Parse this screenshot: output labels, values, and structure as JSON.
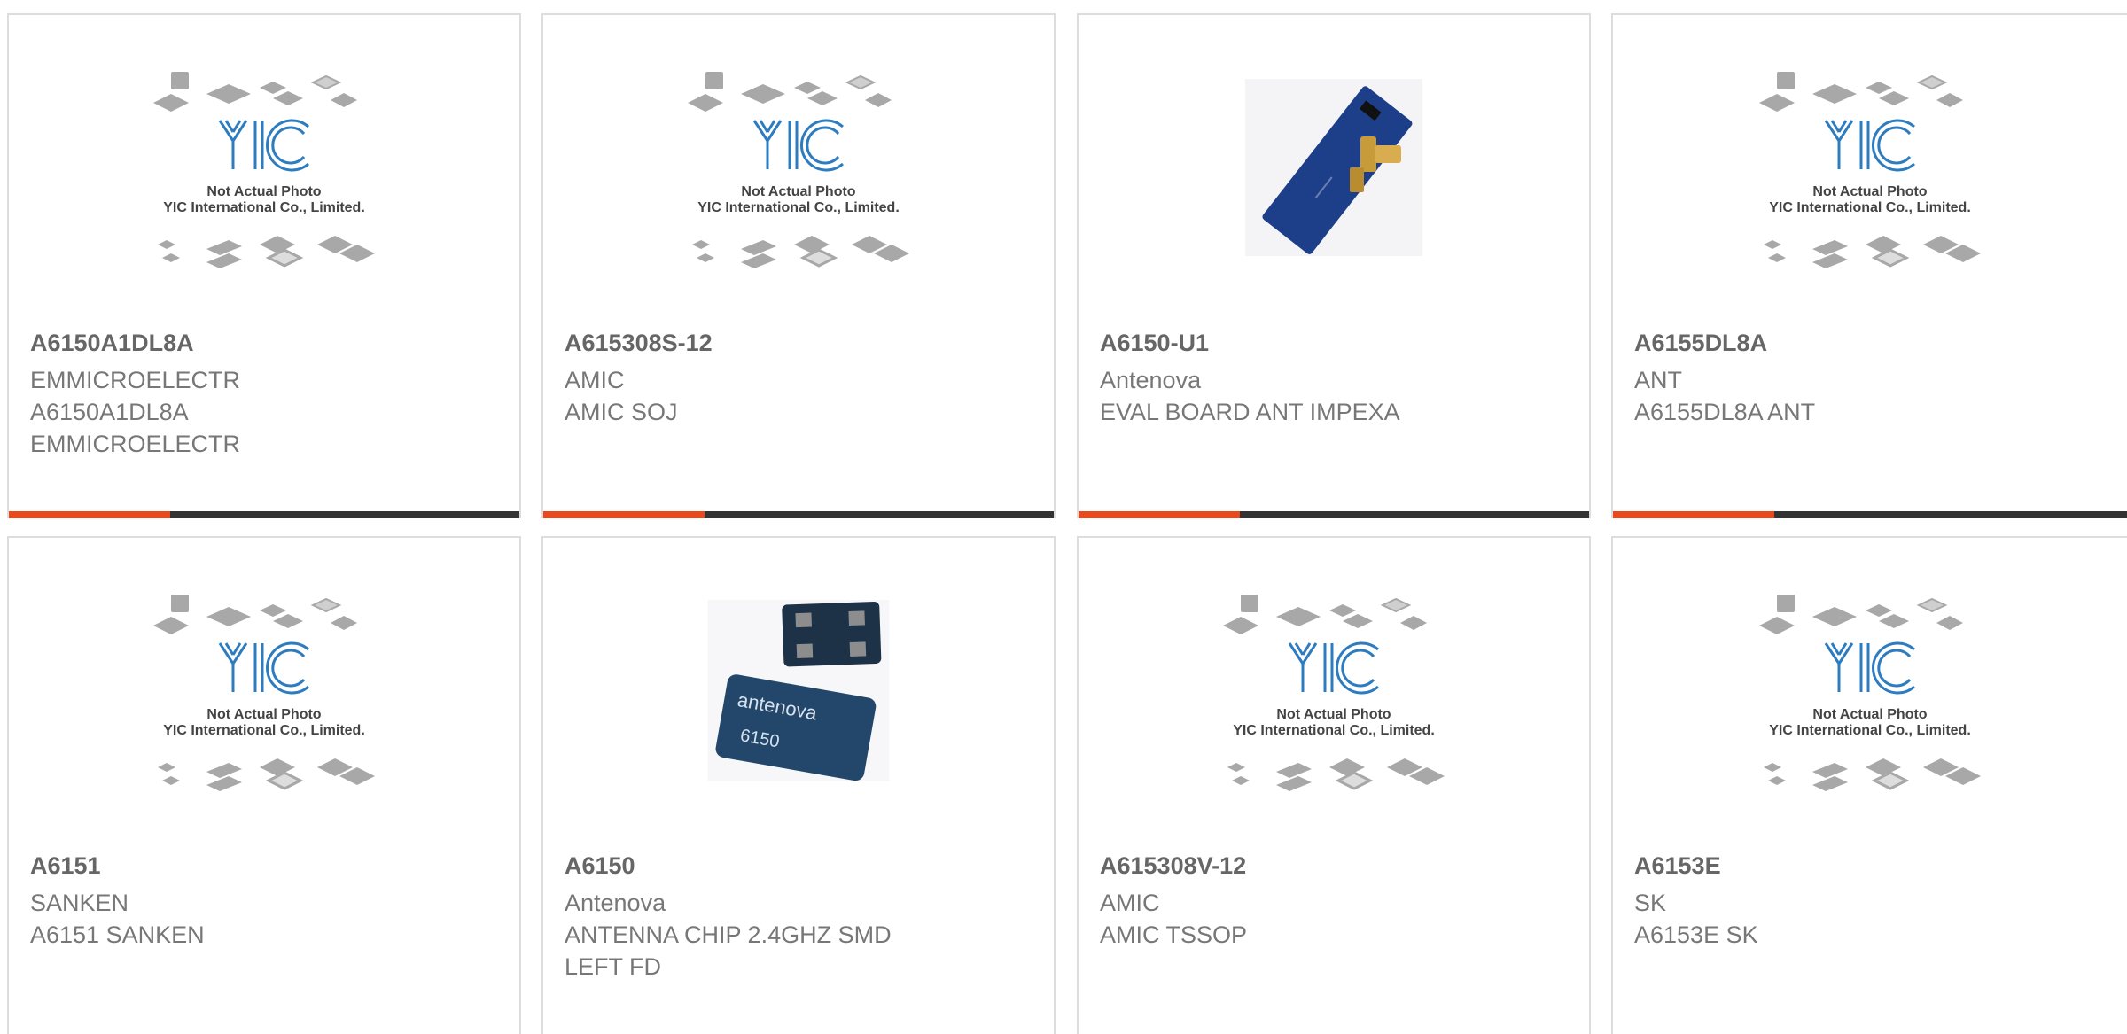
{
  "brand_colors": {
    "accent": "#e84a1d",
    "bar": "#333333",
    "yic_blue": "#2e7cc0"
  },
  "placeholder": {
    "logo_text": "YIC",
    "caption_1": "Not Actual Photo",
    "caption_2": "YIC International Co., Limited."
  },
  "products": [
    {
      "part": "A6150A1DL8A",
      "maker": "EMMICROELECTR",
      "desc_1": "A6150A1DL8A",
      "desc_2": "EMMICROELECTR",
      "image": "placeholder"
    },
    {
      "part": "A615308S-12",
      "maker": "AMIC",
      "desc_1": "AMIC SOJ",
      "desc_2": "",
      "image": "placeholder"
    },
    {
      "part": "A6150-U1",
      "maker": "Antenova",
      "desc_1": "EVAL BOARD ANT IMPEXA",
      "desc_2": "",
      "image": "eval-board"
    },
    {
      "part": "A6155DL8A",
      "maker": "ANT",
      "desc_1": "A6155DL8A ANT",
      "desc_2": "",
      "image": "placeholder"
    },
    {
      "part": "A6151",
      "maker": "SANKEN",
      "desc_1": "A6151 SANKEN",
      "desc_2": "",
      "image": "placeholder"
    },
    {
      "part": "A6150",
      "maker": "Antenova",
      "desc_1": "ANTENNA CHIP 2.4GHZ SMD",
      "desc_2": "LEFT FD",
      "image": "chip-antenna",
      "chip_label_1": "antenova",
      "chip_label_2": "6150"
    },
    {
      "part": "A615308V-12",
      "maker": "AMIC",
      "desc_1": "AMIC TSSOP",
      "desc_2": "",
      "image": "placeholder"
    },
    {
      "part": "A6153E",
      "maker": "SK",
      "desc_1": "A6153E SK",
      "desc_2": "",
      "image": "placeholder"
    }
  ]
}
